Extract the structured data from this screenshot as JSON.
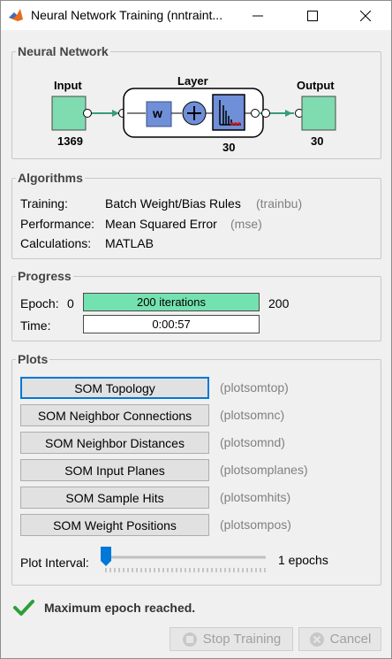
{
  "window": {
    "title": "Neural Network Training (nntraint..."
  },
  "network": {
    "section_title": "Neural Network",
    "input_label": "Input",
    "input_size": "1369",
    "layer_label": "Layer",
    "layer_size": "30",
    "weight_label": "w",
    "output_label": "Output",
    "output_size": "30"
  },
  "algorithms": {
    "section_title": "Algorithms",
    "rows": [
      {
        "label": "Training:",
        "value": "Batch Weight/Bias Rules",
        "func": "(trainbu)"
      },
      {
        "label": "Performance:",
        "value": "Mean Squared Error",
        "func": "(mse)"
      },
      {
        "label": "Calculations:",
        "value": "MATLAB",
        "func": ""
      }
    ]
  },
  "progress": {
    "section_title": "Progress",
    "epoch_label": "Epoch:",
    "epoch_min": "0",
    "epoch_text": "200 iterations",
    "epoch_max": "200",
    "epoch_fraction": 1.0,
    "time_label": "Time:",
    "time_value": "0:00:57"
  },
  "plots": {
    "section_title": "Plots",
    "buttons": [
      {
        "label": "SOM Topology",
        "func": "(plotsomtop)"
      },
      {
        "label": "SOM Neighbor Connections",
        "func": "(plotsomnc)"
      },
      {
        "label": "SOM Neighbor Distances",
        "func": "(plotsomnd)"
      },
      {
        "label": "SOM Input Planes",
        "func": "(plotsomplanes)"
      },
      {
        "label": "SOM Sample Hits",
        "func": "(plotsomhits)"
      },
      {
        "label": "SOM Weight Positions",
        "func": "(plotsompos)"
      }
    ],
    "interval_label": "Plot Interval:",
    "interval_value": "1 epochs"
  },
  "status": {
    "message": "Maximum epoch reached."
  },
  "actions": {
    "stop_label": "Stop Training",
    "cancel_label": "Cancel"
  },
  "colors": {
    "accent_green": "#74e2b0",
    "node_green": "#7fdcb0",
    "weight_blue": "#6f8fd8",
    "focus_blue": "#0078d7"
  }
}
